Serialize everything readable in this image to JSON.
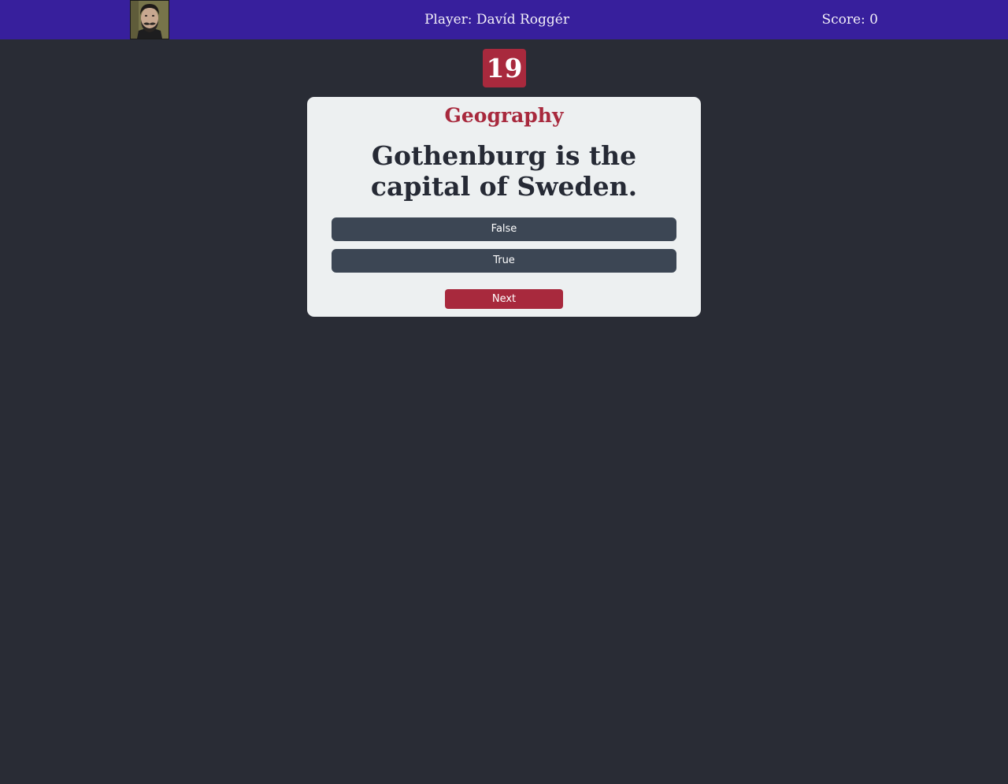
{
  "header": {
    "avatar_icon": "player-avatar-photo",
    "player_label": "Player: Davíd Roggér",
    "score_label": "Score: 0"
  },
  "timer": {
    "value": "19"
  },
  "card": {
    "category": "Geography",
    "question": "Gothenburg is the capital of Sweden.",
    "answers": [
      {
        "label": "False"
      },
      {
        "label": "True"
      }
    ],
    "next_label": "Next"
  },
  "colors": {
    "header_bg": "#371f9c",
    "page_bg": "#292c35",
    "accent": "#a8293d",
    "card_bg": "#edf0f1",
    "answer_bg": "#3c4654"
  }
}
